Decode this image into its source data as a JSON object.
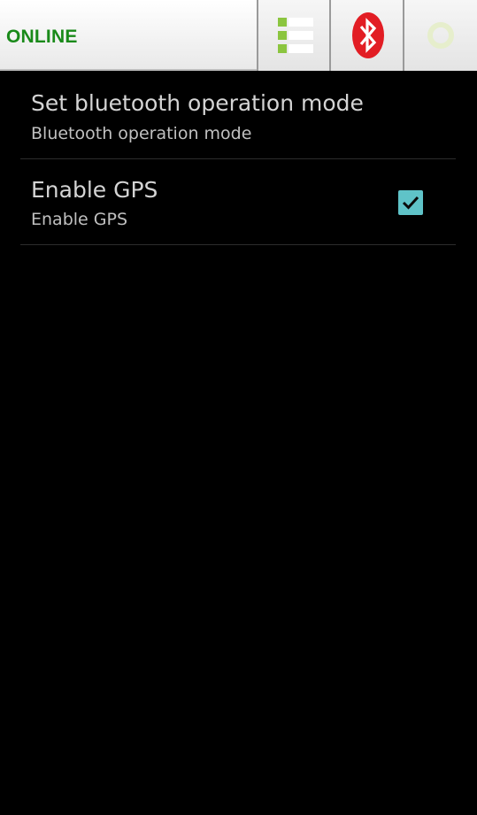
{
  "topbar": {
    "status_text": "ONLINE",
    "status_color": "#1a8a1a",
    "buttons": [
      {
        "icon": "list-icon",
        "accent": "#8bc53f"
      },
      {
        "icon": "bluetooth-icon",
        "accent": "#e21d24"
      },
      {
        "icon": "status-ring-icon",
        "accent": "#e6eecc"
      }
    ]
  },
  "preferences": [
    {
      "title": "Set bluetooth operation mode",
      "summary": "Bluetooth operation mode"
    },
    {
      "title": "Enable GPS",
      "summary": "Enable GPS",
      "checked": true,
      "check_color": "#5fc3c8"
    }
  ]
}
